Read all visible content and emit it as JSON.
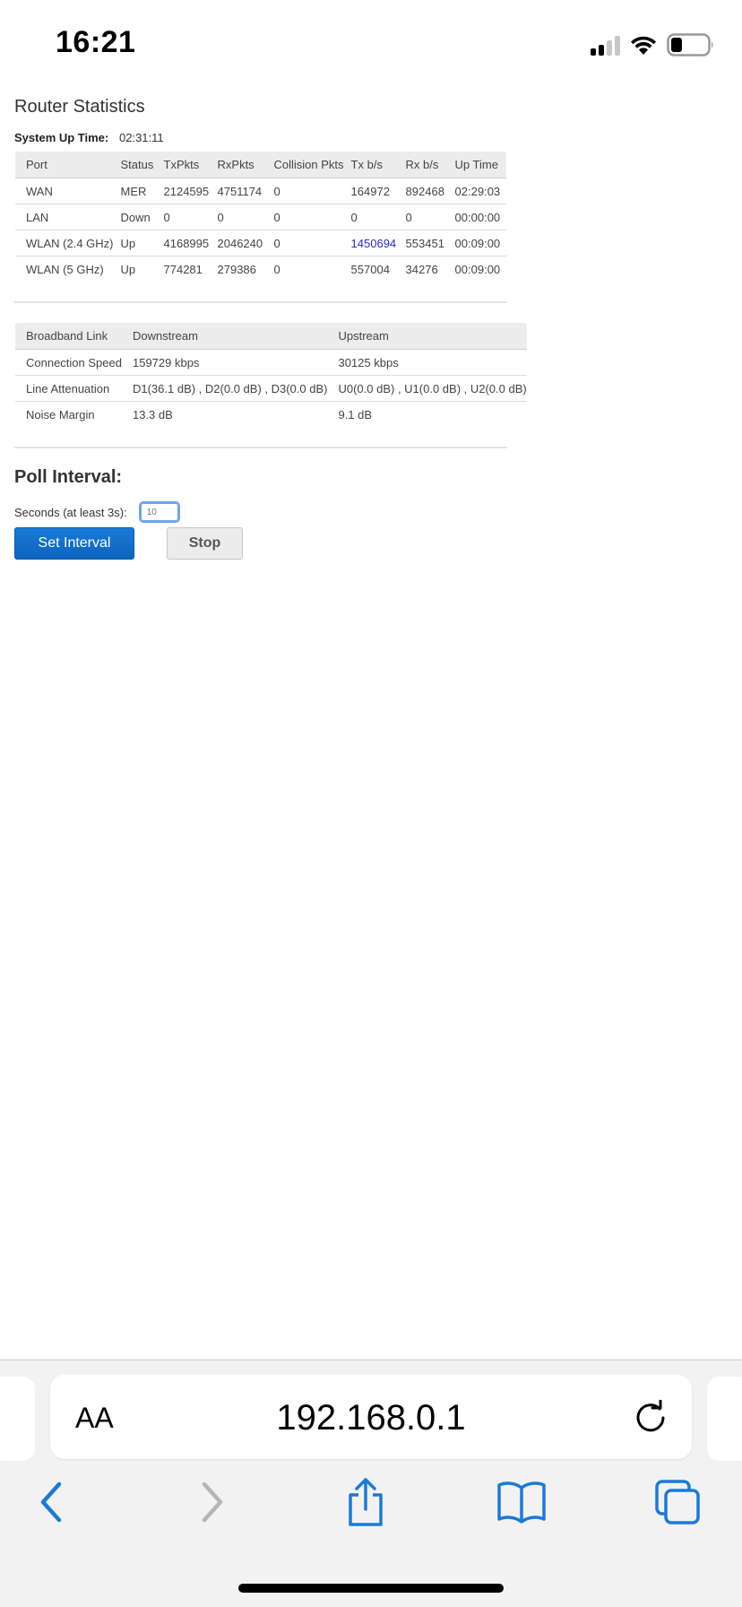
{
  "status_bar": {
    "time": "16:21",
    "icons": [
      "cellular-signal-icon",
      "wifi-icon",
      "battery-icon"
    ]
  },
  "page": {
    "title": "Router Statistics",
    "uptime_label": "System Up Time:",
    "uptime_value": "02:31:11"
  },
  "port_table": {
    "headers": [
      "Port",
      "Status",
      "TxPkts",
      "RxPkts",
      "Collision Pkts",
      "Tx b/s",
      "Rx b/s",
      "Up Time"
    ],
    "rows": [
      [
        "WAN",
        "MER",
        "2124595",
        "4751174",
        "0",
        "164972",
        "892468",
        "02:29:03"
      ],
      [
        "LAN",
        "Down",
        "0",
        "0",
        "0",
        "0",
        "0",
        "00:00:00"
      ],
      [
        "WLAN (2.4 GHz)",
        "Up",
        "4168995",
        "2046240",
        "0",
        "1450694",
        "553451",
        "00:09:00"
      ],
      [
        "WLAN (5 GHz)",
        "Up",
        "774281",
        "279386",
        "0",
        "557004",
        "34276",
        "00:09:00"
      ]
    ],
    "highlight_color": "#2b2bd0"
  },
  "broadband_table": {
    "headers": [
      "Broadband Link",
      "Downstream",
      "Upstream"
    ],
    "rows": [
      [
        "Connection Speed",
        "159729 kbps",
        "30125 kbps"
      ],
      [
        "Line Attenuation",
        "D1(36.1 dB) , D2(0.0 dB) , D3(0.0 dB)",
        "U0(0.0 dB) , U1(0.0 dB) , U2(0.0 dB)"
      ],
      [
        "Noise Margin",
        "13.3 dB",
        "9.1 dB"
      ]
    ]
  },
  "poll": {
    "title": "Poll Interval:",
    "seconds_label": "Seconds (at least 3s):",
    "seconds_value": "10",
    "set_button": "Set Interval",
    "stop_button": "Stop"
  },
  "safari": {
    "text_size_label": "AA",
    "url": "192.168.0.1",
    "accent_color": "#1a7ad9"
  }
}
